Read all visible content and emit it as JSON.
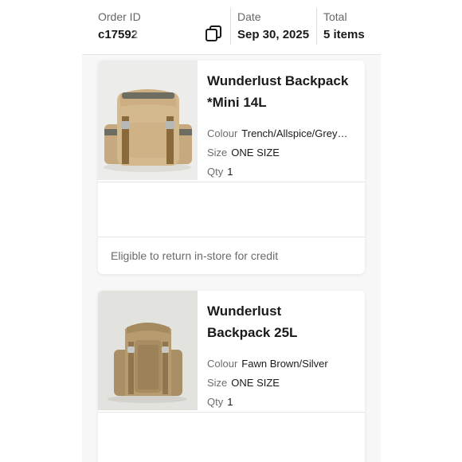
{
  "order": {
    "id_label": "Order ID",
    "id_value": "c17592",
    "date_label": "Date",
    "date_value": "Sep 30, 2025",
    "total_label": "Total",
    "total_value": "5 items"
  },
  "items": [
    {
      "title_line1": "Wunderlust Backpack",
      "title_line2": "*Mini 14L",
      "colour_label": "Colour",
      "colour_value": "Trench/Allspice/Grey…",
      "size_label": "Size",
      "size_value": "ONE SIZE",
      "qty_label": "Qty",
      "qty_value": "1",
      "return_note": "Eligible to return in-store for credit"
    },
    {
      "title_line1": "Wunderlust",
      "title_line2": "Backpack 25L",
      "colour_label": "Colour",
      "colour_value": "Fawn Brown/Silver",
      "size_label": "Size",
      "size_value": "ONE SIZE",
      "qty_label": "Qty",
      "qty_value": "1"
    }
  ],
  "icons": {
    "copy": "copy-icon",
    "product_image_1": "backpack-product-image",
    "product_image_2": "backpack-product-image"
  },
  "colors": {
    "header_background": "#ffffff",
    "page_background": "#f7f7f7",
    "text_primary": "#1a1a1a",
    "text_secondary": "#666666"
  }
}
